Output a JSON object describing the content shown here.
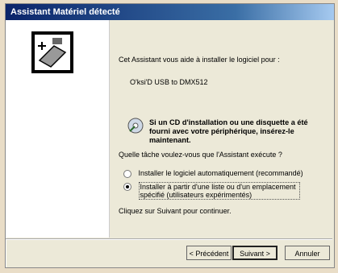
{
  "window": {
    "title": "Assistant Matériel détecté"
  },
  "content": {
    "intro": "Cet Assistant vous aide à installer le logiciel pour :",
    "device": "O'ksi'D USB to DMX512",
    "cd_message": "Si un CD d'installation ou une disquette a été fourni avec votre périphérique, insérez-le maintenant.",
    "question": "Quelle tâche voulez-vous que l'Assistant exécute ?",
    "options": [
      {
        "label": "Installer le logiciel automatiquement (recommandé)",
        "selected": false
      },
      {
        "label": "Installer à partir d'une liste ou d'un emplacement spécifié (utilisateurs expérimentés)",
        "selected": true
      }
    ],
    "continue_hint": "Cliquez sur Suivant pour continuer."
  },
  "buttons": {
    "prev": "< Précédent",
    "next": "Suivant >",
    "cancel": "Annuler"
  },
  "icons": {
    "wizard": "hardware-wizard-icon",
    "cd": "cd-icon"
  }
}
